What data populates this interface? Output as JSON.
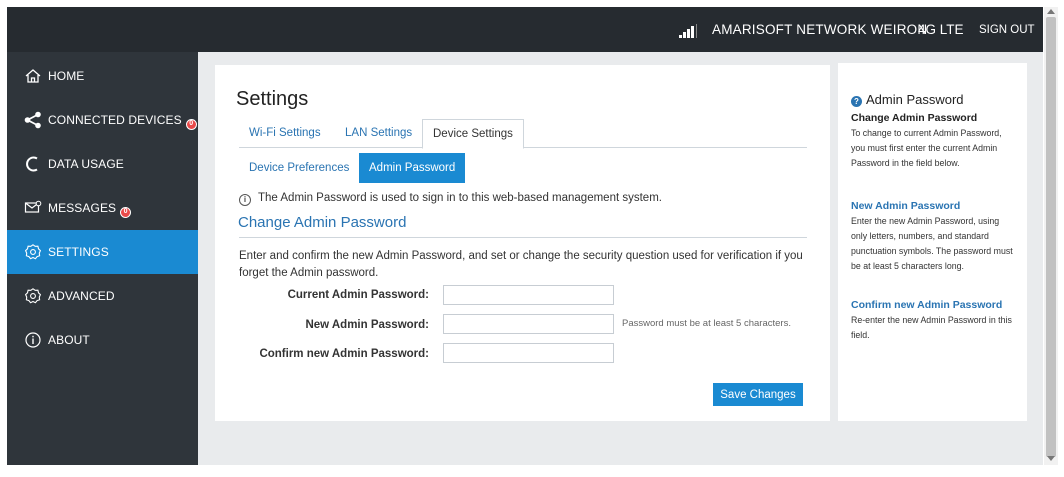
{
  "topbar": {
    "network": "AMARISOFT NETWORK WEIRON",
    "network_type": "4G LTE",
    "signout": "SIGN OUT"
  },
  "sidebar": {
    "items": [
      {
        "label": "HOME",
        "icon": "home-icon"
      },
      {
        "label": "CONNECTED DEVICES",
        "icon": "share-icon",
        "badge": "0"
      },
      {
        "label": "DATA USAGE",
        "icon": "gauge-icon"
      },
      {
        "label": "MESSAGES",
        "icon": "messages-icon",
        "badge": "0"
      },
      {
        "label": "SETTINGS",
        "icon": "settings-icon",
        "active": true
      },
      {
        "label": "ADVANCED",
        "icon": "advanced-gear-icon"
      },
      {
        "label": "ABOUT",
        "icon": "info-icon"
      }
    ]
  },
  "main": {
    "title": "Settings",
    "tabs": [
      "Wi-Fi Settings",
      "LAN Settings",
      "Device Settings"
    ],
    "subtabs": [
      "Device Preferences",
      "Admin Password"
    ],
    "info": "The Admin Password is used to sign in to this web-based management system.",
    "section_title": "Change Admin Password",
    "description": "Enter and confirm the new Admin Password, and set or change the security question used for verification if you forget the Admin password.",
    "fields": {
      "current_label": "Current Admin Password:",
      "new_label": "New Admin Password:",
      "confirm_label": "Confirm new Admin Password:",
      "current_value": "",
      "new_value": "",
      "confirm_value": ""
    },
    "hint": "Password must be at least 5 characters.",
    "save": "Save Changes"
  },
  "help": {
    "title": "Admin Password",
    "s1_title": "Change Admin Password",
    "s1_body": "To change to current Admin Password, you must first enter the current Admin Password in the field below.",
    "s2_title": "New Admin Password",
    "s2_body": "Enter the new Admin Password, using only letters, numbers, and standard punctuation symbols. The password must be at least 5 characters long.",
    "s3_title": "Confirm new Admin Password",
    "s3_body": "Re-enter the new Admin Password in this field."
  },
  "colors": {
    "accent": "#1a8ad2",
    "sidebar": "#2f353b",
    "topbar": "#262b30",
    "link": "#2a74b2"
  }
}
